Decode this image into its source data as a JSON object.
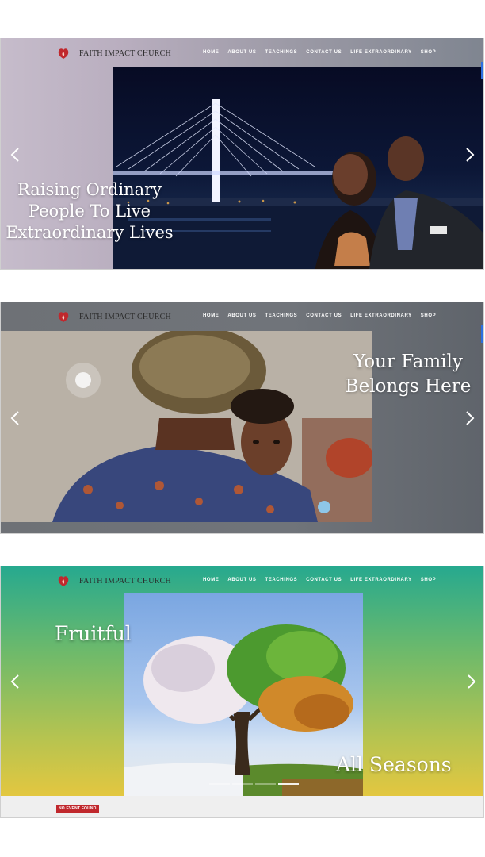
{
  "site": {
    "logo_text": "FAITH IMPACT CHURCH",
    "nav": [
      "HOME",
      "ABOUT US",
      "TEACHINGS",
      "CONTACT US",
      "LIFE EXTRAORDINARY",
      "SHOP"
    ]
  },
  "slides": [
    {
      "headline_lines": [
        "Raising Ordinary",
        "People To Live",
        "Extraordinary Lives"
      ]
    },
    {
      "headline_lines": [
        "Your Family",
        "Belongs Here"
      ]
    },
    {
      "headline_top": "Fruitful",
      "headline_bottom": "All Seasons",
      "event_badge": "NO EVENT FOUND"
    }
  ],
  "colors": {
    "accent": "#2d6fe0",
    "badge": "#c0282d",
    "logo_red": "#c0282d"
  },
  "icons": {
    "prev": "chevron-left-icon",
    "next": "chevron-right-icon",
    "logo": "flame-heart-icon"
  }
}
